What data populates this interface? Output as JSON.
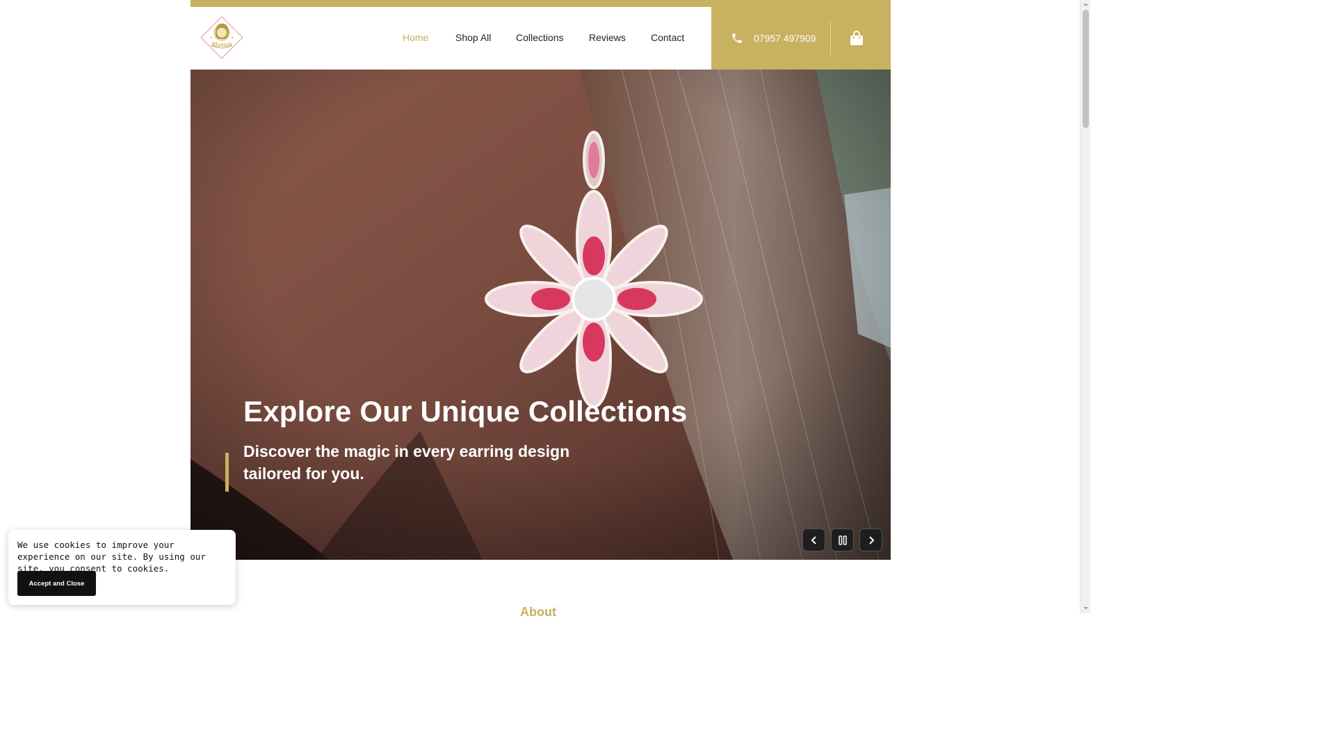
{
  "header": {
    "logo_alt": "Blasiah",
    "nav": [
      {
        "label": "Home",
        "active": true
      },
      {
        "label": "Shop All",
        "active": false
      },
      {
        "label": "Collections",
        "active": false
      },
      {
        "label": "Reviews",
        "active": false
      },
      {
        "label": "Contact",
        "active": false
      }
    ],
    "phone": "07957 497909"
  },
  "hero": {
    "title": "Explore Our Unique Collections",
    "subtitle": "Discover the magic in every earring design tailored for you."
  },
  "slider_controls": {
    "prev": "chevron-left-icon",
    "pause": "pause-icon",
    "next": "chevron-right-icon"
  },
  "about": {
    "heading": "About"
  },
  "cookie_banner": {
    "text": "We use cookies to improve your experience on our site. By using our site, you consent to cookies.",
    "button_label": "Accept and Close"
  },
  "colors": {
    "accent": "#c8b15f",
    "dark": "#1e1e1e"
  }
}
